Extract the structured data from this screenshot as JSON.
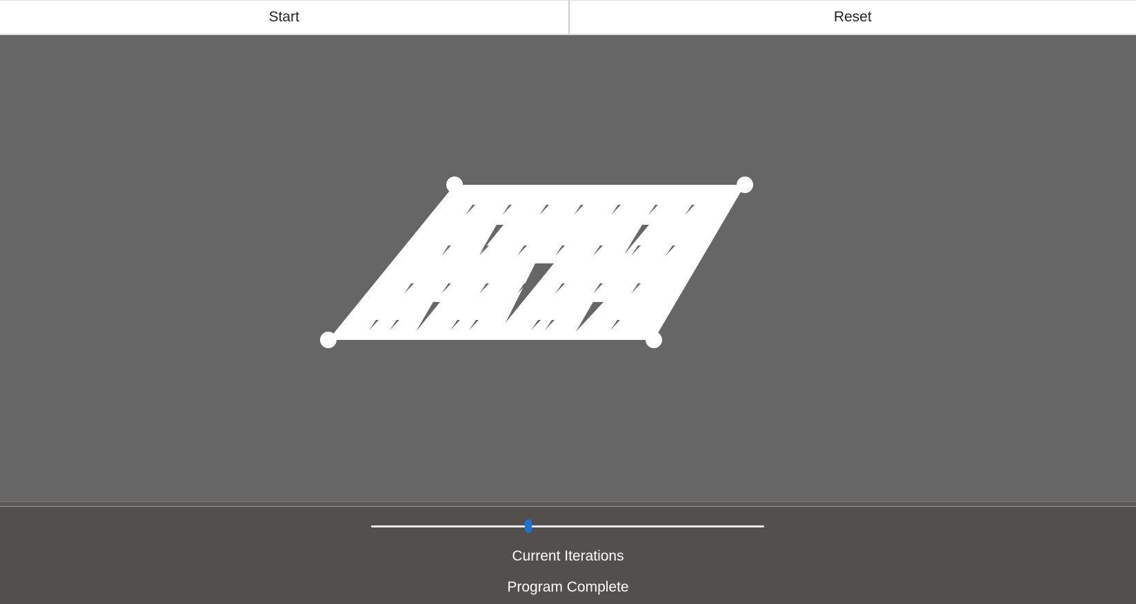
{
  "toolbar": {
    "start_label": "Start",
    "reset_label": "Reset"
  },
  "canvas": {
    "background_color": "#666666",
    "fill_color": "#ffffff",
    "hole_color": "#666666",
    "control_point_count": 4
  },
  "slider": {
    "value_fraction": 0.4,
    "thumb_color": "#1a73d6"
  },
  "labels": {
    "iterations": "Current Iterations",
    "status": "Program Complete"
  }
}
